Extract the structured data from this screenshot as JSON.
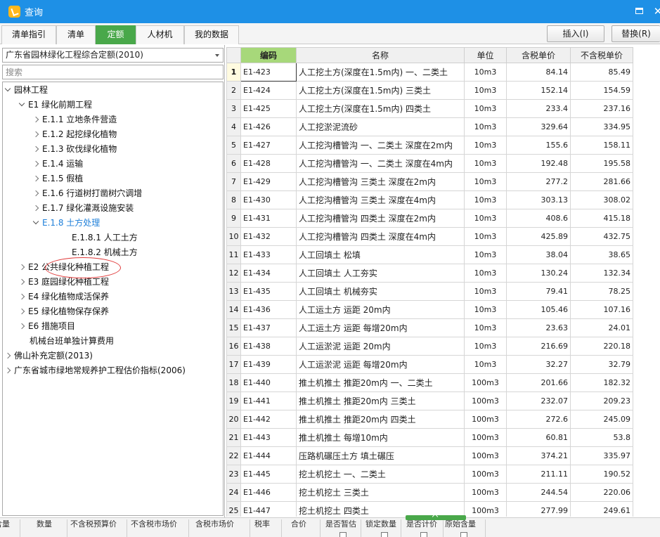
{
  "window": {
    "title": "查询",
    "maximize_icon": "maximize-icon",
    "close_glyph": "✕"
  },
  "tabs": [
    {
      "label": "清单指引",
      "active": false
    },
    {
      "label": "清单",
      "active": false
    },
    {
      "label": "定额",
      "active": true
    },
    {
      "label": "人材机",
      "active": false
    },
    {
      "label": "我的数据",
      "active": false
    }
  ],
  "actions": {
    "insert_label": "插入(I)",
    "replace_label": "替换(R)"
  },
  "left": {
    "quota_library": "广东省园林绿化工程综合定额(2010)",
    "search_placeholder": "搜索",
    "tree": [
      {
        "label": "园林工程",
        "toggle": "down",
        "selected": false
      },
      {
        "label": "E1 绿化前期工程",
        "toggle": "down",
        "selected": false
      },
      {
        "label": "E.1.1 立地条件营造",
        "toggle": "right",
        "selected": false
      },
      {
        "label": "E.1.2 起挖绿化植物",
        "toggle": "right",
        "selected": false
      },
      {
        "label": "E.1.3 砍伐绿化植物",
        "toggle": "right",
        "selected": false
      },
      {
        "label": "E.1.4 运输",
        "toggle": "right",
        "selected": false
      },
      {
        "label": "E.1.5 假植",
        "toggle": "right",
        "selected": false
      },
      {
        "label": "E.1.6 行道树打凿树穴调增",
        "toggle": "right",
        "selected": false
      },
      {
        "label": "E.1.7 绿化灌溉设施安装",
        "toggle": "right",
        "selected": false
      },
      {
        "label": "E.1.8 土方处理",
        "toggle": "down",
        "selected": true
      },
      {
        "label": "E.1.8.1 人工土方",
        "toggle": "none",
        "selected": false
      },
      {
        "label": "E.1.8.2 机械土方",
        "toggle": "none",
        "selected": false
      },
      {
        "label": "E2 公共绿化种植工程",
        "toggle": "right",
        "selected": false
      },
      {
        "label": "E3 庭园绿化种植工程",
        "toggle": "right",
        "selected": false
      },
      {
        "label": "E4 绿化植物成活保养",
        "toggle": "right",
        "selected": false
      },
      {
        "label": "E5 绿化植物保存保养",
        "toggle": "right",
        "selected": false
      },
      {
        "label": "E6 措施项目",
        "toggle": "right",
        "selected": false
      },
      {
        "label": "机械台班单独计算费用",
        "toggle": "none",
        "selected": false
      },
      {
        "label": "佛山补充定额(2013)",
        "toggle": "right",
        "selected": false
      },
      {
        "label": "广东省城市绿地常规养护工程估价指标(2006)",
        "toggle": "right",
        "selected": false
      }
    ]
  },
  "grid": {
    "headers": [
      "",
      "编码",
      "名称",
      "单位",
      "含税单价",
      "不含税单价"
    ],
    "rows": [
      [
        "1",
        "E1-423",
        "人工挖土方(深度在1.5m内) 一、二类土",
        "10m3",
        "84.14",
        "85.49"
      ],
      [
        "2",
        "E1-424",
        "人工挖土方(深度在1.5m内) 三类土",
        "10m3",
        "152.14",
        "154.59"
      ],
      [
        "3",
        "E1-425",
        "人工挖土方(深度在1.5m内) 四类土",
        "10m3",
        "233.4",
        "237.16"
      ],
      [
        "4",
        "E1-426",
        "人工挖淤泥流砂",
        "10m3",
        "329.64",
        "334.95"
      ],
      [
        "5",
        "E1-427",
        "人工挖沟槽管沟 一、二类土 深度在2m内",
        "10m3",
        "155.6",
        "158.11"
      ],
      [
        "6",
        "E1-428",
        "人工挖沟槽管沟 一、二类土 深度在4m内",
        "10m3",
        "192.48",
        "195.58"
      ],
      [
        "7",
        "E1-429",
        "人工挖沟槽管沟 三类土 深度在2m内",
        "10m3",
        "277.2",
        "281.66"
      ],
      [
        "8",
        "E1-430",
        "人工挖沟槽管沟 三类土 深度在4m内",
        "10m3",
        "303.13",
        "308.02"
      ],
      [
        "9",
        "E1-431",
        "人工挖沟槽管沟 四类土 深度在2m内",
        "10m3",
        "408.6",
        "415.18"
      ],
      [
        "10",
        "E1-432",
        "人工挖沟槽管沟 四类土 深度在4m内",
        "10m3",
        "425.89",
        "432.75"
      ],
      [
        "11",
        "E1-433",
        "人工回填土 松填",
        "10m3",
        "38.04",
        "38.65"
      ],
      [
        "12",
        "E1-434",
        "人工回填土 人工夯实",
        "10m3",
        "130.24",
        "132.34"
      ],
      [
        "13",
        "E1-435",
        "人工回填土 机械夯实",
        "10m3",
        "79.41",
        "78.25"
      ],
      [
        "14",
        "E1-436",
        "人工运土方 运距 20m内",
        "10m3",
        "105.46",
        "107.16"
      ],
      [
        "15",
        "E1-437",
        "人工运土方 运距 每增20m内",
        "10m3",
        "23.63",
        "24.01"
      ],
      [
        "16",
        "E1-438",
        "人工运淤泥 运距 20m内",
        "10m3",
        "216.69",
        "220.18"
      ],
      [
        "17",
        "E1-439",
        "人工运淤泥 运距 每增20m内",
        "10m3",
        "32.27",
        "32.79"
      ],
      [
        "18",
        "E1-440",
        "推土机推土 推距20m内 一、二类土",
        "100m3",
        "201.66",
        "182.32"
      ],
      [
        "19",
        "E1-441",
        "推土机推土 推距20m内 三类土",
        "100m3",
        "232.07",
        "209.23"
      ],
      [
        "20",
        "E1-442",
        "推土机推土 推距20m内 四类土",
        "100m3",
        "272.6",
        "245.09"
      ],
      [
        "21",
        "E1-443",
        "推土机推土 每增10m内",
        "100m3",
        "60.81",
        "53.8"
      ],
      [
        "22",
        "E1-444",
        "压路机碾压土方 填土碾压",
        "100m3",
        "374.21",
        "335.97"
      ],
      [
        "23",
        "E1-445",
        "挖土机挖土 一、二类土",
        "100m3",
        "211.11",
        "190.52"
      ],
      [
        "24",
        "E1-446",
        "挖土机挖土 三类土",
        "100m3",
        "244.54",
        "220.06"
      ],
      [
        "25",
        "E1-447",
        "挖土机挖土 四类土",
        "100m3",
        "277.99",
        "249.61"
      ]
    ]
  },
  "bottom": {
    "headers": [
      "含量",
      "数量",
      "不含税预算价",
      "不含税市场价",
      "含税市场价",
      "税率",
      "合价",
      "是否暂估",
      "锁定数量",
      "是否计价",
      "原始含量"
    ]
  }
}
